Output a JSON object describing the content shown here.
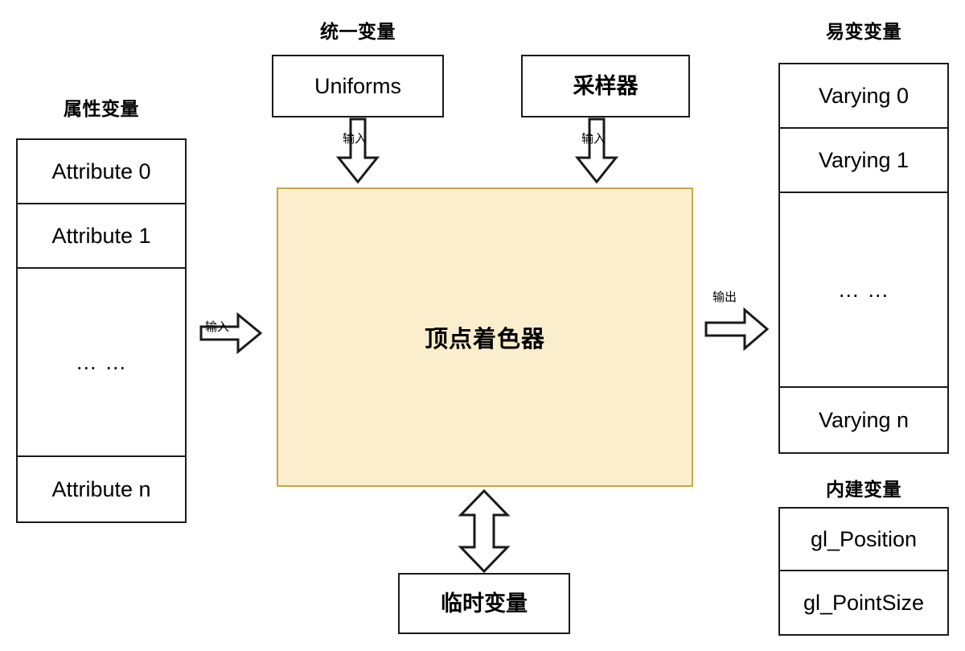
{
  "diagram": {
    "title_text": "顶点着色器",
    "colors": {
      "shader_fill": "#faeecd",
      "shader_border": "#c8a84a",
      "line": "#1a1a1a",
      "background": "#ffffff"
    }
  },
  "attributes": {
    "caption": "属性变量",
    "cells": [
      {
        "label": "Attribute 0"
      },
      {
        "label": "Attribute 1"
      },
      {
        "label": "… …"
      },
      {
        "label": "Attribute n"
      }
    ]
  },
  "uniforms": {
    "caption": "统一变量",
    "box_label": "Uniforms",
    "arrow_label": "输入"
  },
  "sampler": {
    "box_label": "采样器",
    "arrow_label": "输入"
  },
  "shader": {
    "label": "顶点着色器"
  },
  "attribute_arrow": {
    "label": "输入"
  },
  "output_arrow": {
    "label": "输出"
  },
  "varyings": {
    "caption": "易变变量",
    "cells": [
      {
        "label": "Varying 0"
      },
      {
        "label": "Varying 1"
      },
      {
        "label": "… …"
      },
      {
        "label": "Varying n"
      }
    ]
  },
  "builtins": {
    "caption": "内建变量",
    "cells": [
      {
        "label": "gl_Position"
      },
      {
        "label": "gl_PointSize"
      }
    ]
  },
  "temporaries": {
    "box_label": "临时变量"
  }
}
